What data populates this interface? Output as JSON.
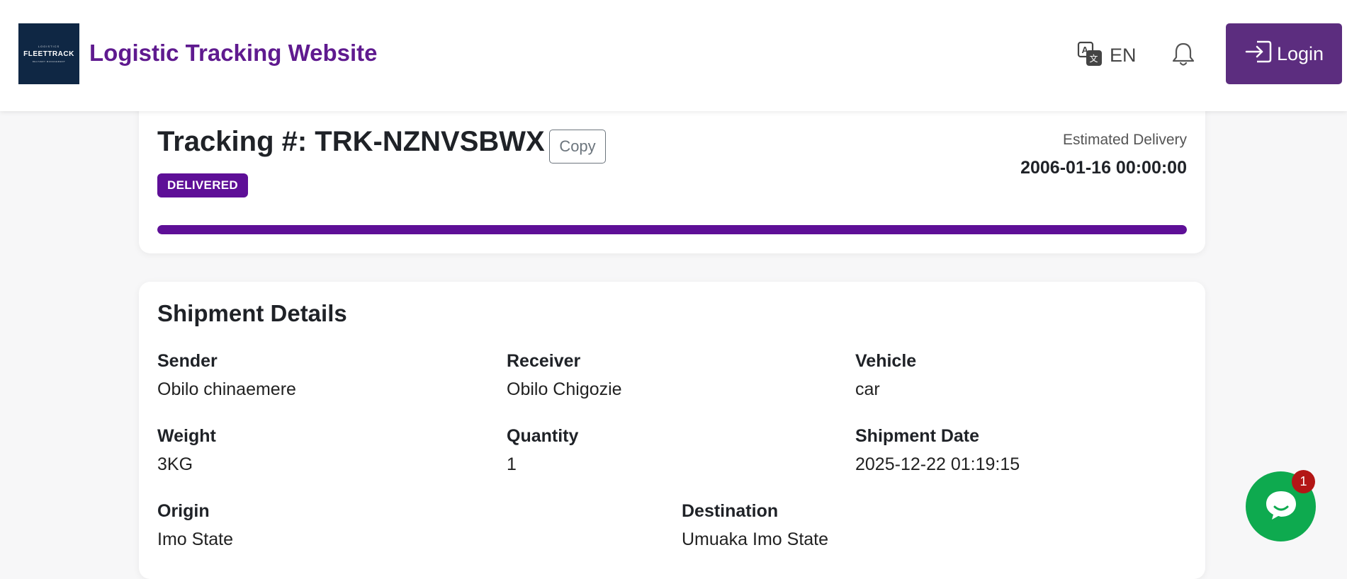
{
  "header": {
    "logo": {
      "top_text": "LOGISTICS",
      "main_text": "FLEETTRACK",
      "sub_text": "DELIVERY MANAGEMENT"
    },
    "title": "Logistic Tracking Website",
    "language": "EN",
    "login_label": "Login"
  },
  "tracking": {
    "title": "Tracking #: TRK-NZNVSBWX",
    "copy_label": "Copy",
    "status": "DELIVERED",
    "estimated_label": "Estimated Delivery",
    "estimated_value": "2006-01-16 00:00:00",
    "progress_percent": 100
  },
  "details": {
    "title": "Shipment Details",
    "fields": [
      {
        "label": "Sender",
        "value": "Obilo chinaemere"
      },
      {
        "label": "Receiver",
        "value": "Obilo Chigozie"
      },
      {
        "label": "Vehicle",
        "value": "car"
      },
      {
        "label": "Weight",
        "value": "3KG"
      },
      {
        "label": "Quantity",
        "value": "1"
      },
      {
        "label": "Shipment Date",
        "value": "2025-12-22 01:19:15"
      },
      {
        "label": "Origin",
        "value": "Imo State"
      },
      {
        "label": "Destination",
        "value": "Umuaka Imo State"
      }
    ]
  },
  "chat": {
    "badge_count": "1",
    "icon": "chat-bubble-icon"
  },
  "colors": {
    "brand": "#5f1a8f",
    "badge": "#5e0f97",
    "login": "#5c2d7f",
    "chat": "#0eaa4f",
    "notification": "#b31616"
  }
}
